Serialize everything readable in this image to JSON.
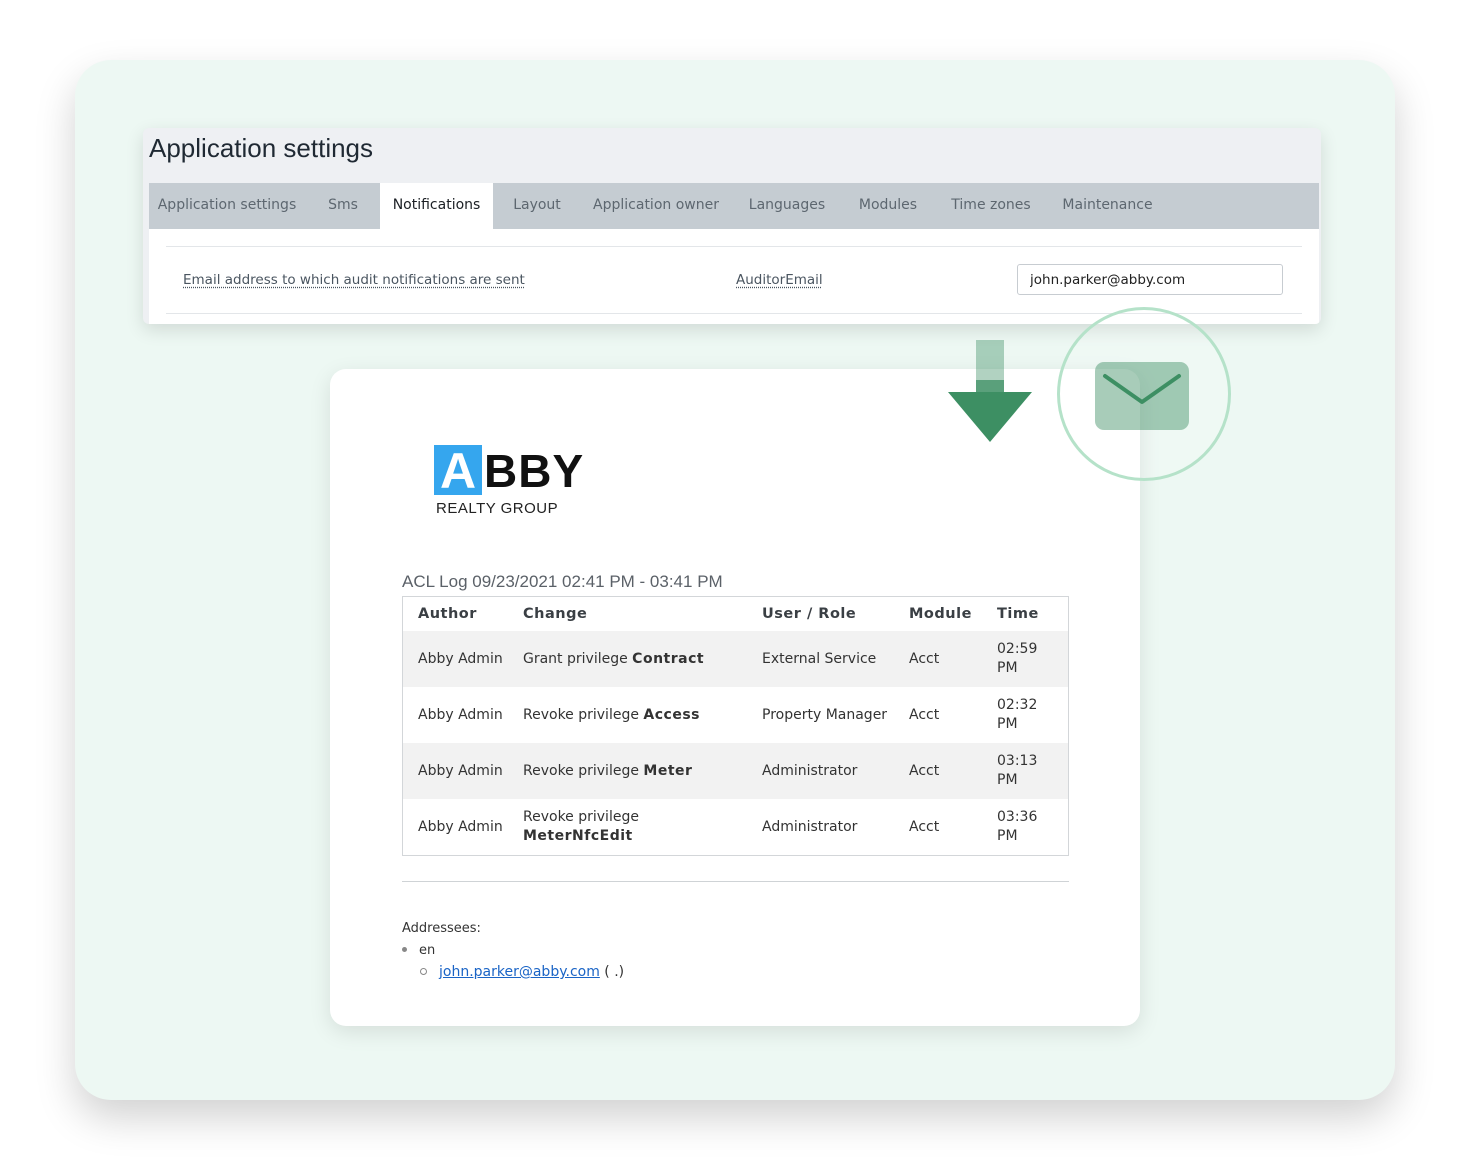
{
  "settings": {
    "title": "Application settings",
    "tabs": [
      {
        "label": "Application settings",
        "active": false
      },
      {
        "label": "Sms",
        "active": false
      },
      {
        "label": "Notifications",
        "active": true
      },
      {
        "label": "Layout",
        "active": false
      },
      {
        "label": "Application owner",
        "active": false
      },
      {
        "label": "Languages",
        "active": false
      },
      {
        "label": "Modules",
        "active": false
      },
      {
        "label": "Time zones",
        "active": false
      },
      {
        "label": "Maintenance",
        "active": false
      }
    ],
    "row": {
      "description": "Email address to which audit notifications are sent",
      "key": "AuditorEmail",
      "value": "john.parker@abby.com"
    }
  },
  "graphics": {
    "arrow_icon": "arrow-down-icon",
    "envelope_icon": "envelope-icon",
    "accent_color": "#3d8f63"
  },
  "email": {
    "logo": {
      "mark": "A",
      "rest": "BBY",
      "sub": "REALTY GROUP",
      "accent": "#35a6ee"
    },
    "log_title": "ACL Log 09/23/2021 02:41 PM - 03:41 PM",
    "columns": [
      "Author",
      "Change",
      "User / Role",
      "Module",
      "Time"
    ],
    "rows": [
      {
        "author": "Abby Admin",
        "change_prefix": "Grant privilege",
        "privilege": "Contract",
        "role": "External Service",
        "module": "Acct",
        "time": "02:59 PM"
      },
      {
        "author": "Abby Admin",
        "change_prefix": "Revoke privilege",
        "privilege": "Access",
        "role": "Property Manager",
        "module": "Acct",
        "time": "02:32 PM"
      },
      {
        "author": "Abby Admin",
        "change_prefix": "Revoke privilege",
        "privilege": "Meter",
        "role": "Administrator",
        "module": "Acct",
        "time": "03:13 PM"
      },
      {
        "author": "Abby Admin",
        "change_prefix": "Revoke privilege",
        "privilege": "MeterNfcEdit",
        "role": "Administrator",
        "module": "Acct",
        "time": "03:36 PM"
      }
    ],
    "addressees": {
      "title": "Addressees:",
      "language": "en",
      "email": "john.parker@abby.com",
      "suffix": "( .)"
    }
  }
}
